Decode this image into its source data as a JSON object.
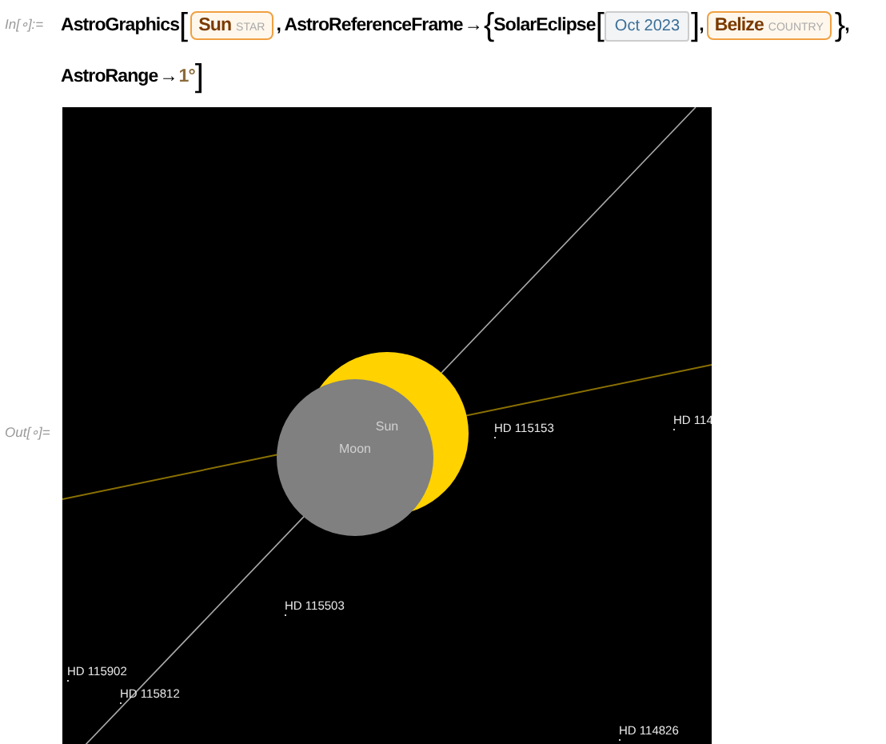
{
  "input": {
    "label": "In[∘]:=",
    "lines": [
      [
        {
          "kind": "text",
          "text": "AstroGraphics"
        },
        {
          "kind": "bracket",
          "text": "["
        },
        {
          "kind": "entity",
          "name": "Sun",
          "type": "STAR"
        },
        {
          "kind": "text",
          "text": ", AstroReferenceFrame"
        },
        {
          "kind": "arrow",
          "text": "→"
        },
        {
          "kind": "bracket",
          "text": "{"
        },
        {
          "kind": "text",
          "text": "SolarEclipse"
        },
        {
          "kind": "bracket",
          "text": "["
        },
        {
          "kind": "date",
          "text": "Oct 2023"
        },
        {
          "kind": "bracket",
          "text": "]"
        },
        {
          "kind": "text",
          "text": ","
        },
        {
          "kind": "entity",
          "name": "Belize",
          "type": "COUNTRY"
        },
        {
          "kind": "bracket",
          "text": "}"
        },
        {
          "kind": "text",
          "text": ","
        }
      ],
      [
        {
          "kind": "text",
          "text": "AstroRange"
        },
        {
          "kind": "arrow",
          "text": "→"
        },
        {
          "kind": "number",
          "text": "1°"
        },
        {
          "kind": "bracket",
          "text": "]"
        }
      ]
    ]
  },
  "output": {
    "label": "Out[∘]=",
    "bodies": [
      {
        "kind": "sun",
        "name": "Sun"
      },
      {
        "kind": "moon",
        "name": "Moon"
      }
    ],
    "stars": [
      "HD 115153",
      "HD 114",
      "HD 115503",
      "HD 115902",
      "HD 115812",
      "HD 114826"
    ]
  }
}
